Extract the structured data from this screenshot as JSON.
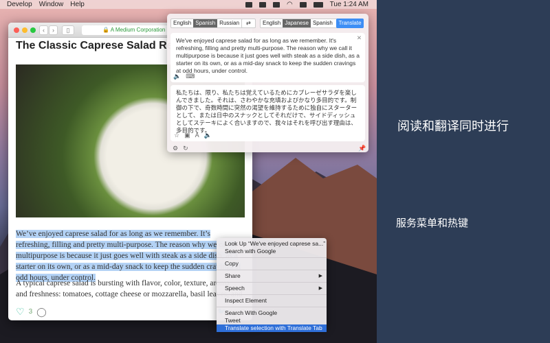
{
  "menubar": {
    "items": [
      "Develop",
      "Window",
      "Help"
    ],
    "clock": "Tue 1:24 AM"
  },
  "browser": {
    "url": "A Medium Corporation",
    "title": "The Classic Caprese Salad Recipe —",
    "para1": "We’ve enjoyed caprese salad for as long as we remember. It’s refreshing, filling and pretty multi-purpose. The reason why we call it multipurpose is because it just goes well with steak as a side dish, as a starter on its own, or as a mid-day snack to keep the sudden cravings at odd hours, under control.",
    "para2": "A typical caprese salad is bursting with flavor, color, texture, aroma and freshness: tomatoes, cottage cheese or mozzarella, basil leaves, and olive oil.",
    "likes": "3"
  },
  "translator": {
    "source_langs": [
      "English",
      "Spanish",
      "Russian"
    ],
    "source_selected": "Spanish",
    "target_langs": [
      "English",
      "Japanese",
      "Spanish"
    ],
    "target_selected": "Japanese",
    "translate_label": "Translate",
    "source_text": "We've enjoyed caprese salad for as long as we remember. It's refreshing, filling and pretty multi-purpose. The reason why we call it multipurpose is because it just goes well with steak as a side dish, as a starter on its own, or as a mid-day snack to keep the sudden cravings at odd hours, under control.",
    "result_text": "私たちは、限り、私たちは覚えているためにカプレーゼサラダを楽しんできました。それは、さわやかな充填およびかなり多目的です。制御の下で、奇数時間に突然の渇望を維持するために独自にスターターとして、または日中のスナックとしてそれだけで、サイドディッシュとしてステーキによく合いますので、我々はそれを呼び出す理由は、多目的です。"
  },
  "context_menu": {
    "items": [
      "Look Up “We've enjoyed caprese sa...”",
      "Search with Google",
      "Copy",
      "Share",
      "Speech",
      "Inspect Element",
      "Search With Google",
      "Tweet",
      "Translate selection with Translate Tab"
    ]
  },
  "side": {
    "caption1": "阅读和翻译同时进行",
    "caption2": "服务菜单和热键"
  },
  "colors": {
    "side_bg": "#2d3d56",
    "accent": "#3d8ef5",
    "selection": "#b3d2f5"
  }
}
